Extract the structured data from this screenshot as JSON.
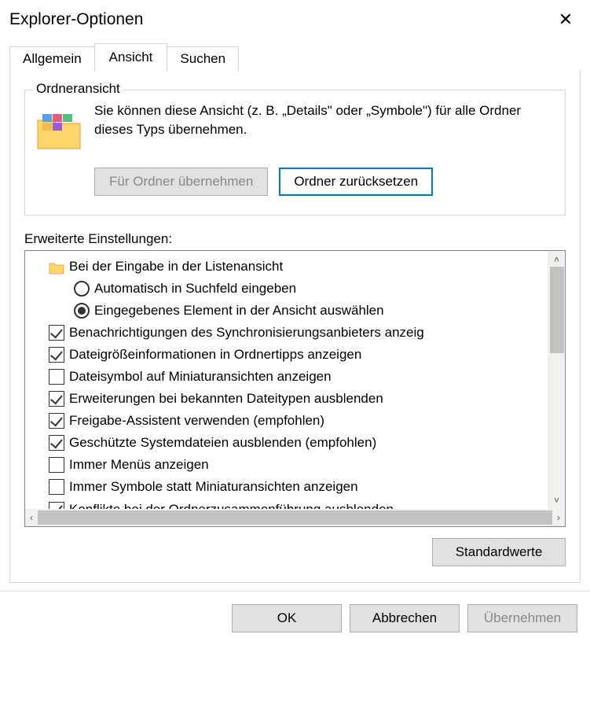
{
  "window": {
    "title": "Explorer-Optionen"
  },
  "tabs": {
    "general": "Allgemein",
    "view": "Ansicht",
    "search": "Suchen"
  },
  "folderViews": {
    "legend": "Ordneransicht",
    "description": "Sie können diese Ansicht (z. B. „Details\" oder „Symbole\") für alle Ordner dieses Typs übernehmen.",
    "applyBtn": "Für Ordner übernehmen",
    "resetBtn": "Ordner zurücksetzen"
  },
  "advanced": {
    "label": "Erweiterte Einstellungen:",
    "items": [
      {
        "type": "group",
        "level": 0,
        "label": "Bei der Eingabe in der Listenansicht"
      },
      {
        "type": "radio",
        "level": 1,
        "checked": false,
        "label": "Automatisch in Suchfeld eingeben"
      },
      {
        "type": "radio",
        "level": 1,
        "checked": true,
        "label": "Eingegebenes Element in der Ansicht auswählen"
      },
      {
        "type": "check",
        "level": 0,
        "checked": true,
        "label": "Benachrichtigungen des Synchronisierungsanbieters anzeig"
      },
      {
        "type": "check",
        "level": 0,
        "checked": true,
        "label": "Dateigrößeinformationen in Ordnertipps anzeigen"
      },
      {
        "type": "check",
        "level": 0,
        "checked": false,
        "label": "Dateisymbol auf Miniaturansichten anzeigen"
      },
      {
        "type": "check",
        "level": 0,
        "checked": true,
        "label": "Erweiterungen bei bekannten Dateitypen ausblenden"
      },
      {
        "type": "check",
        "level": 0,
        "checked": true,
        "label": "Freigabe-Assistent verwenden (empfohlen)"
      },
      {
        "type": "check",
        "level": 0,
        "checked": true,
        "label": "Geschützte Systemdateien ausblenden (empfohlen)"
      },
      {
        "type": "check",
        "level": 0,
        "checked": false,
        "label": "Immer Menüs anzeigen"
      },
      {
        "type": "check",
        "level": 0,
        "checked": false,
        "label": "Immer Symbole statt Miniaturansichten anzeigen"
      },
      {
        "type": "check",
        "level": 0,
        "checked": true,
        "label": "Konflikte bei der Ordnerzusammenführung ausblenden"
      }
    ],
    "defaultsBtn": "Standardwerte"
  },
  "footer": {
    "ok": "OK",
    "cancel": "Abbrechen",
    "apply": "Übernehmen"
  }
}
